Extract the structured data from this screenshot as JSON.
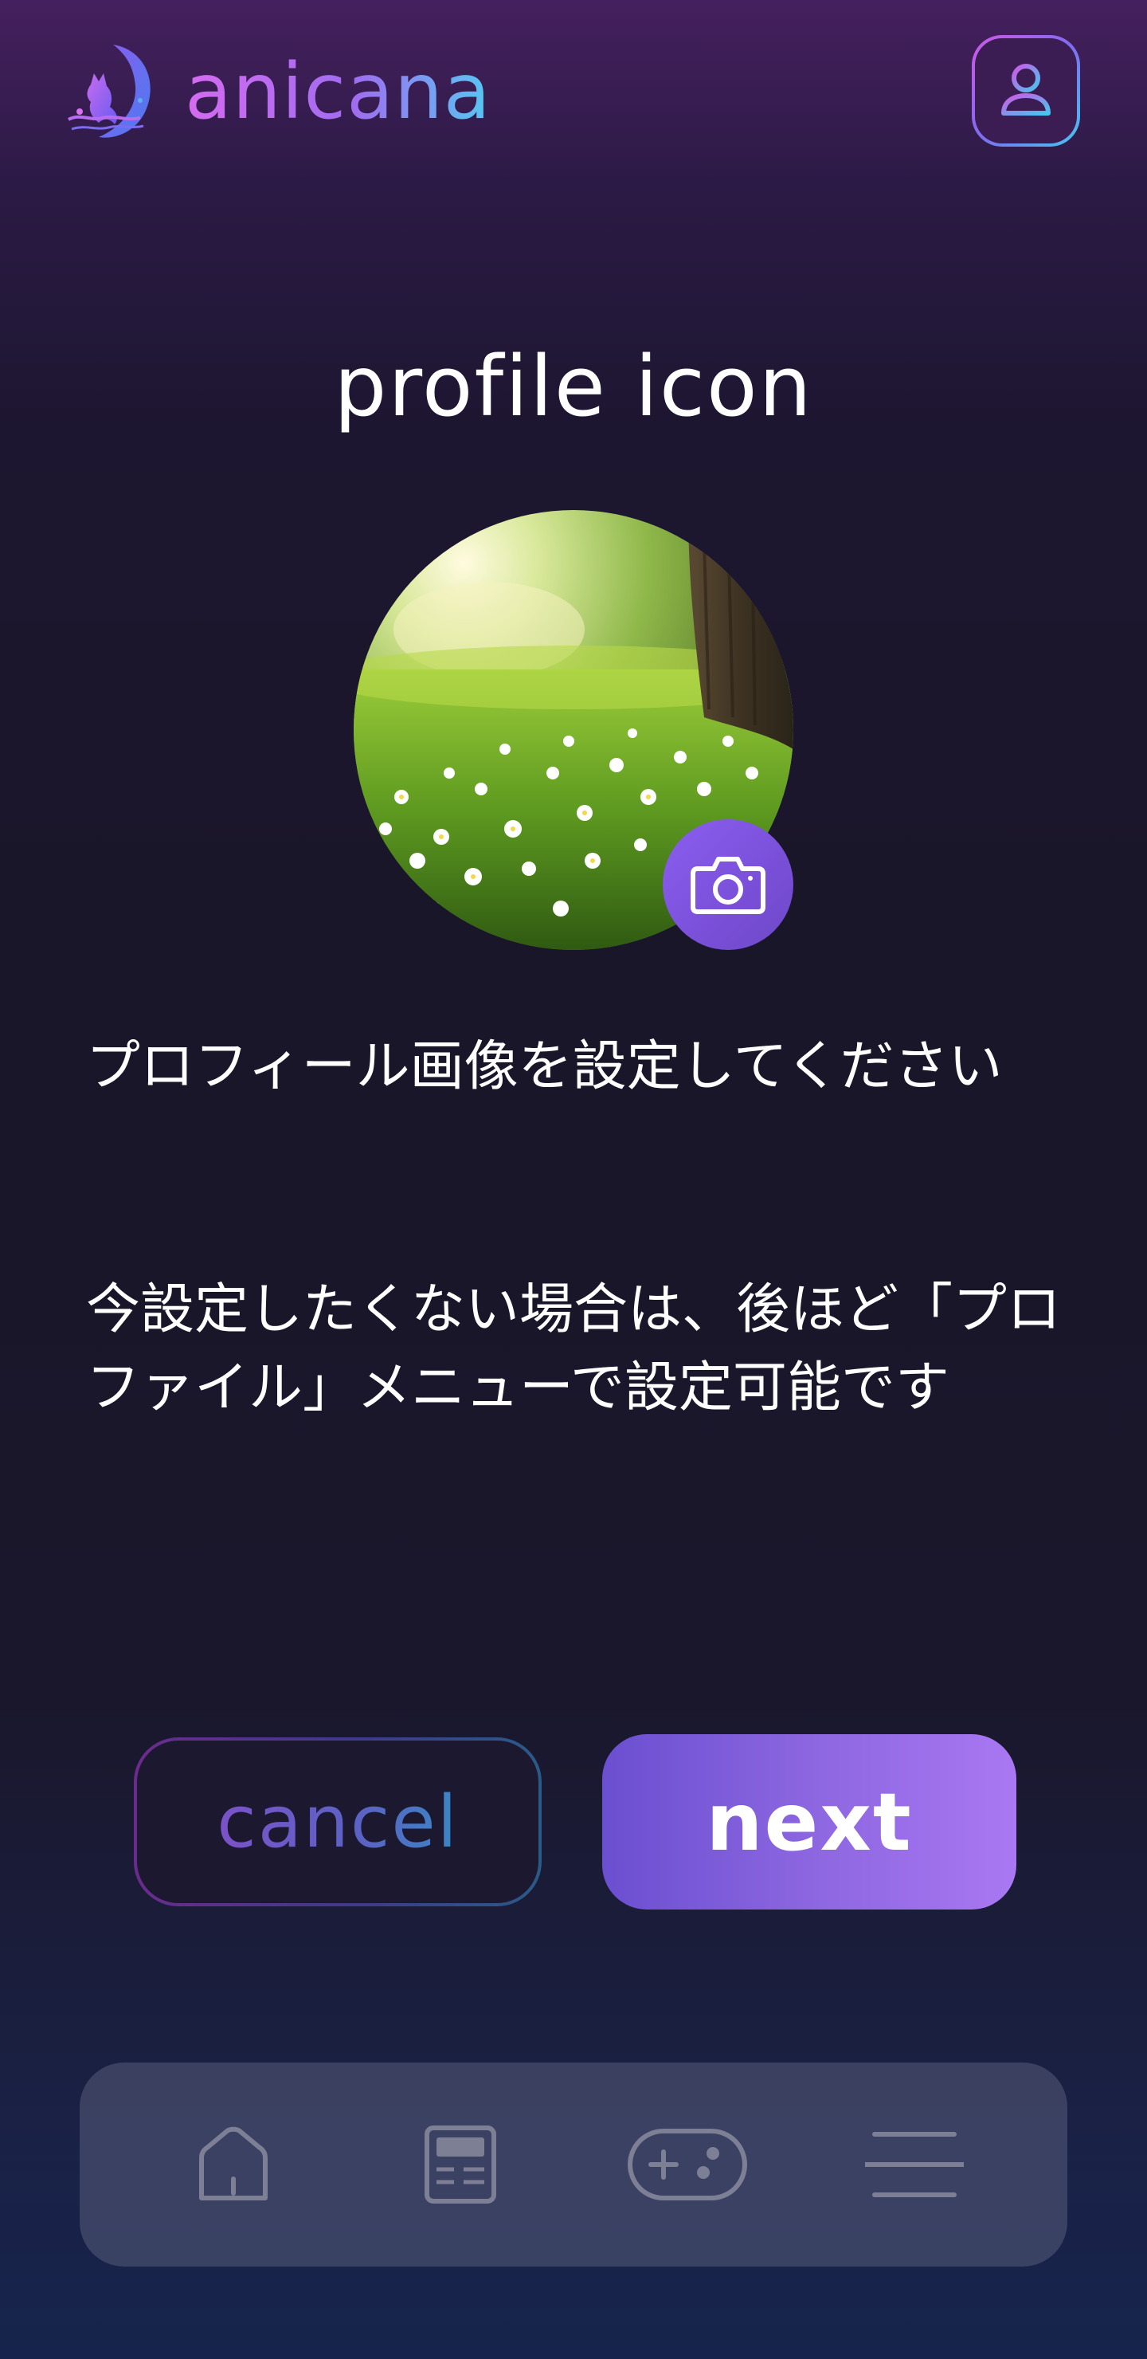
{
  "header": {
    "brand": "anicana",
    "logo_icon": "crescent-moon-cat-logo",
    "account_icon": "user-icon"
  },
  "page": {
    "title": "profile icon"
  },
  "avatar": {
    "image": "meadow-flowers-tree-sunlight",
    "camera_icon": "camera-icon"
  },
  "messages": {
    "line1": "プロフィール画像を設定してください",
    "line2": "今設定したくない場合は、後ほど「プロファイル」メニューで設定可能です"
  },
  "actions": {
    "cancel_label": "cancel",
    "next_label": "next"
  },
  "bottom_nav": {
    "items": [
      {
        "icon": "home-icon"
      },
      {
        "icon": "news-icon"
      },
      {
        "icon": "gamepad-icon"
      },
      {
        "icon": "menu-icon"
      }
    ]
  },
  "colors": {
    "accent_start": "#d56bf0",
    "accent_end": "#55c8f2",
    "primary_button": "#8c66e0",
    "background": "#1a1629"
  }
}
